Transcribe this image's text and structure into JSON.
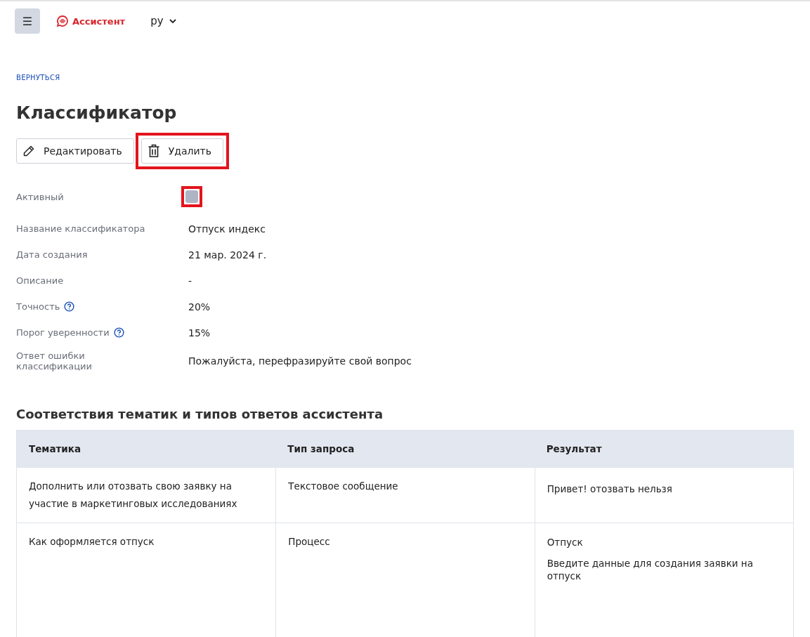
{
  "header": {
    "menu_button": "☰",
    "brand": "Ассистент",
    "language": "ру"
  },
  "back_link": "ВЕРНУТЬСЯ",
  "title": "Классификатор",
  "actions": [
    {
      "kind": "edit",
      "label": "Редактировать",
      "highlighted": false
    },
    {
      "kind": "delete",
      "label": "Удалить",
      "highlighted": true
    }
  ],
  "fields": [
    {
      "kind": "checkbox",
      "label": "Активный",
      "checked": false,
      "disabled": true,
      "highlighted": true
    },
    {
      "kind": "text",
      "label": "Название классификатора",
      "value": "Отпуск индекс",
      "help": false
    },
    {
      "kind": "text",
      "label": "Дата создания",
      "value": "21 мар. 2024 г.",
      "help": false
    },
    {
      "kind": "text",
      "label": "Описание",
      "value": "-",
      "help": false
    },
    {
      "kind": "text",
      "label": "Точность",
      "value": "20%",
      "help": true
    },
    {
      "kind": "text",
      "label": "Порог уверенности",
      "value": "15%",
      "help": true
    },
    {
      "kind": "text",
      "label": "Ответ ошибки классификации",
      "value": "Пожалуйста, перефразируйте свой вопрос",
      "help": false
    }
  ],
  "mapping": {
    "title": "Соответствия тематик и типов ответов ассистента",
    "columns": [
      "Тематика",
      "Тип запроса",
      "Результат"
    ],
    "rows": [
      {
        "topic": "Дополнить или отозвать свою заявку на участие в маркетинговых исследованиях",
        "request_type": "Текстовое сообщение",
        "result": [
          "Привет! отозвать нельзя"
        ]
      },
      {
        "topic": "Как оформляется отпуск",
        "request_type": "Процесс",
        "result": [
          "Отпуск",
          "Введите данные для создания заявки на отпуск"
        ]
      }
    ]
  }
}
